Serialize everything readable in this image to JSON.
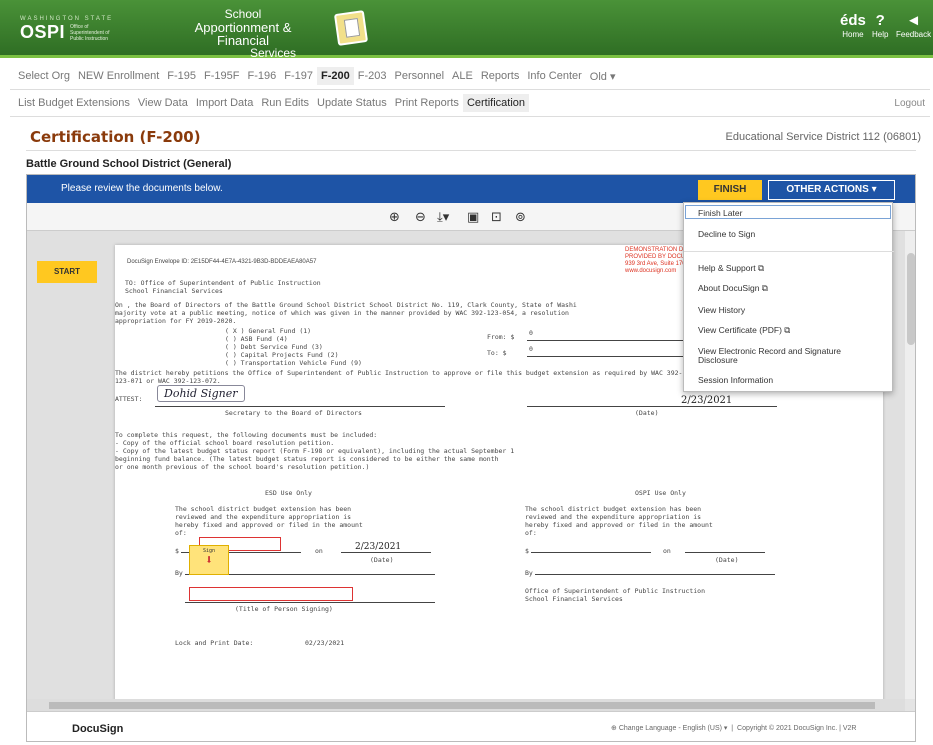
{
  "header": {
    "logo_small": "WASHINGTON STATE",
    "logo_main": "OSPI",
    "logo_sub": "Office of Superintendent of Public Instruction",
    "app_title_1": "School",
    "app_title_2": "Apportionment & Financial",
    "app_title_3": "Services",
    "nav": [
      {
        "icon": "éds",
        "label": "Home"
      },
      {
        "icon": "?",
        "label": "Help"
      },
      {
        "icon": "◄",
        "label": "Feedback"
      }
    ]
  },
  "menu_primary": [
    "Select Org",
    "NEW Enrollment",
    "F-195",
    "F-195F",
    "F-196",
    "F-197",
    "F-200",
    "F-203",
    "Personnel",
    "ALE",
    "Reports",
    "Info Center",
    "Old ▾"
  ],
  "menu_primary_active": "F-200",
  "menu_secondary": [
    "List Budget Extensions",
    "View Data",
    "Import Data",
    "Run Edits",
    "Update Status",
    "Print Reports",
    "Certification"
  ],
  "menu_secondary_active": "Certification",
  "logout": "Logout",
  "page_title": "Certification (F-200)",
  "esd": "Educational Service District 112 (06801)",
  "district": "Battle Ground School District (General)",
  "docusign": {
    "banner": "Please review the documents below.",
    "finish": "FINISH",
    "other_actions": "OTHER ACTIONS ▾",
    "start": "START",
    "footer_logo": "DocuSign",
    "footer_lang": "Change Language - English (US) ▾",
    "footer_copy": "Copyright © 2021 DocuSign Inc. | V2R"
  },
  "dropdown": {
    "group1": [
      "Finish Later",
      "Decline to Sign"
    ],
    "group2": [
      "Help & Support ⧉",
      "About DocuSign ⧉",
      "View History",
      "View Certificate (PDF) ⧉",
      "View Electronic Record and Signature",
      "Disclosure",
      "Session Information"
    ]
  },
  "doc": {
    "envelope": "DocuSign Envelope ID: 2E15DF44-4E7A-4321-9B3D-BDDEAEA80A57",
    "demo_1": "DEMONSTRATION DO",
    "demo_2": "PROVIDED BY DOCUS",
    "demo_3": "939 3rd Ave, Suite 170",
    "demo_4": "www.docusign.com",
    "to_1": "TO:   Office of Superintendent of Public Instruction",
    "to_2": "      School Financial Services",
    "body_1": "On , the Board of Directors of the Battle Ground School District School District No. 119, Clark County, State of Washi",
    "body_2": "majority vote at a public meeting, notice of which was given in the manner provided by WAC 392-123-054, a resolution",
    "body_3": "appropriation for FY 2019-2020.",
    "fund_1": "( X )  General Fund (1)",
    "fund_2": "(   )  ASB Fund (4)",
    "fund_3": "(   )  Debt Service Fund (3)",
    "fund_4": "(   )  Capital Projects Fund (2)",
    "fund_5": "(   )  Transportation Vehicle Fund (9)",
    "from": "From: $",
    "to": "To:   $",
    "from_val": "0",
    "to_val": "0",
    "petition_1": "The district hereby petitions the Office of Superintendent of Public Instruction to approve or file this budget extension as required by WAC 392-",
    "petition_2": "123-071 or WAC 392-123-072.",
    "attest": "ATTEST:",
    "signature": "Dohid Signer",
    "sig_caption": "Secretary to the Board of Directors",
    "date_1": "2/23/2021",
    "date_caption": "(Date)",
    "req_1": "To complete this request, the following documents must be included:",
    "req_2": "- Copy of the official school board resolution petition.",
    "req_3": "- Copy of the latest budget status report (Form F-198 or equivalent), including the actual September 1",
    "req_4": "  beginning fund balance. (The latest budget status report is considered to be either the same month",
    "req_5": "  or one month previous of the school board's resolution petition.)",
    "esd_only": "ESD Use Only",
    "ospi_only": "OSPI Use Only",
    "esd_text_1": "The school district budget extension has been",
    "esd_text_2": "reviewed and the expenditure appropriation is",
    "esd_text_3": "hereby fixed and approved or filed in the amount",
    "esd_text_4": "of:",
    "dollar": "$",
    "on": "on",
    "date_2": "2/23/2021",
    "by": "By",
    "sign_label": "Sign",
    "title_caption": "(Title of Person Signing)",
    "ospi_office_1": "Office of Superintendent of Public Instruction",
    "ospi_office_2": "School Financial Services",
    "lock": "Lock and Print Date:",
    "lock_date": "02/23/2021"
  },
  "colors": {
    "header_green": "#3a7d2c",
    "title_brown": "#8a3a0b",
    "docusign_blue": "#1e54a6",
    "finish_yellow": "#ffc820",
    "demo_red": "#d32222"
  }
}
